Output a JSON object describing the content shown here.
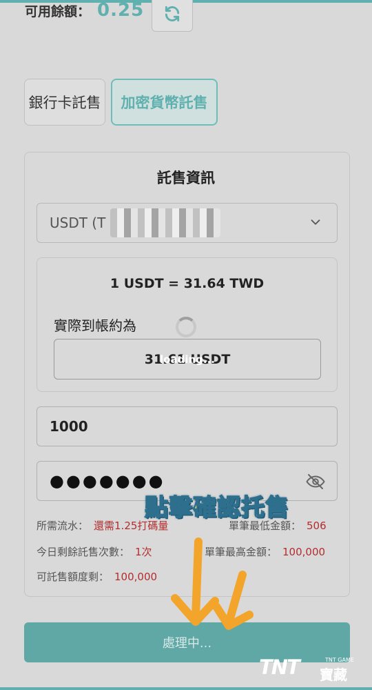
{
  "balance": {
    "label": "可用餘額：",
    "value": "0.25"
  },
  "tabs": [
    {
      "label": "銀行卡託售"
    },
    {
      "label": "加密貨幣託售"
    }
  ],
  "panel": {
    "title": "託售資訊",
    "currency_select": {
      "value": "USDT (T"
    },
    "rate": "1 USDT = 31.64 TWD",
    "arrive_label": "實際到帳約為",
    "arrive_value": "31.61 USDT",
    "loading_text": "loading..."
  },
  "amount_input": {
    "value": "1000"
  },
  "password_input": {
    "value": "●●●●●●●"
  },
  "overlay_caption": "點擊確認托售",
  "info": {
    "turnover_label": "所需流水：",
    "turnover_value": "還需1.25打碼量",
    "min_label": "單筆最低金額：",
    "min_value": "506",
    "remaining_times_label": "今日剩餘託售次數：",
    "remaining_times_value": "1次",
    "max_label": "單筆最高金額：",
    "max_value": "100,000",
    "remaining_amount_label": "可託售額度剩：",
    "remaining_amount_value": "100,000"
  },
  "submit_button": {
    "label": "處理中..."
  },
  "watermark": {
    "brand": "TNT",
    "sub": "TNT GAME",
    "cn": "寶藏"
  },
  "colors": {
    "accent": "#5fb0ae",
    "value_red": "#b32d2d",
    "caption_yellow": "#ffe95a",
    "arrow_orange": "#f2a52a"
  }
}
